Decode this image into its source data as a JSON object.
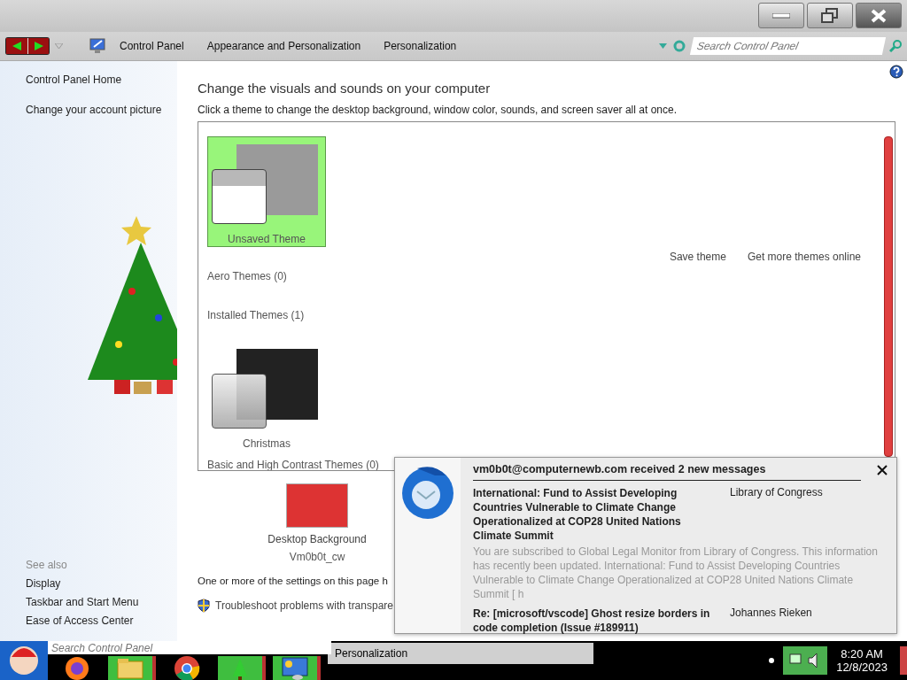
{
  "address_bar": {
    "breadcrumbs": [
      "Control Panel",
      "Appearance and Personalization",
      "Personalization"
    ],
    "search": {
      "placeholder": "Search Control Panel"
    }
  },
  "sidebar": {
    "links": [
      "Control Panel Home",
      "Change your account picture"
    ],
    "see_also": {
      "title": "See also",
      "links": [
        "Display",
        "Taskbar and Start Menu",
        "Ease of Access Center"
      ]
    }
  },
  "main": {
    "title": "Change the visuals and sounds on your computer",
    "subtitle": "Click a theme to change the desktop background, window color, sounds, and screen saver all at once.",
    "theme_groups": [
      {
        "items": [
          {
            "name": "Unsaved Theme",
            "selected": true,
            "kind": "comic"
          }
        ],
        "actions": [
          "Save theme",
          "Get more themes online"
        ]
      },
      {
        "title": "Aero Themes (0)"
      },
      {
        "title": "Installed Themes (1)",
        "items": [
          {
            "name": "Christmas",
            "selected": false,
            "kind": "dark"
          }
        ]
      },
      {
        "title": "Basic and High Contrast Themes (0)"
      }
    ],
    "desktop_background": {
      "label": "Desktop Background",
      "value": "Vm0b0t_cw"
    },
    "notice": "One or more of the settings on this page h",
    "troubleshoot_link": "Troubleshoot problems with transpare"
  },
  "notification": {
    "title": "vm0b0t@computernewb.com received 2 new messages",
    "messages": [
      {
        "subject": "International: Fund to Assist Developing Countries Vulnerable to Climate Change Operationalized at COP28 United Nations Climate Summit",
        "sender": "Library of Congress",
        "preview": "You are subscribed to Global Legal Monitor from Library of Congress. This information has recently been updated. International: Fund to Assist Developing Countries Vulnerable to Climate Change Operationalized at COP28 United Nations Climate Summit [ h"
      },
      {
        "subject": "Re: [microsoft/vscode] Ghost resize borders in code completion (Issue #189911)",
        "sender": "Johannes Rieken"
      }
    ]
  },
  "taskbar": {
    "search": {
      "placeholder": "Search Control Panel"
    },
    "task": "Personalization",
    "clock": {
      "time": "8:20 AM",
      "date": "12/8/2023"
    }
  }
}
